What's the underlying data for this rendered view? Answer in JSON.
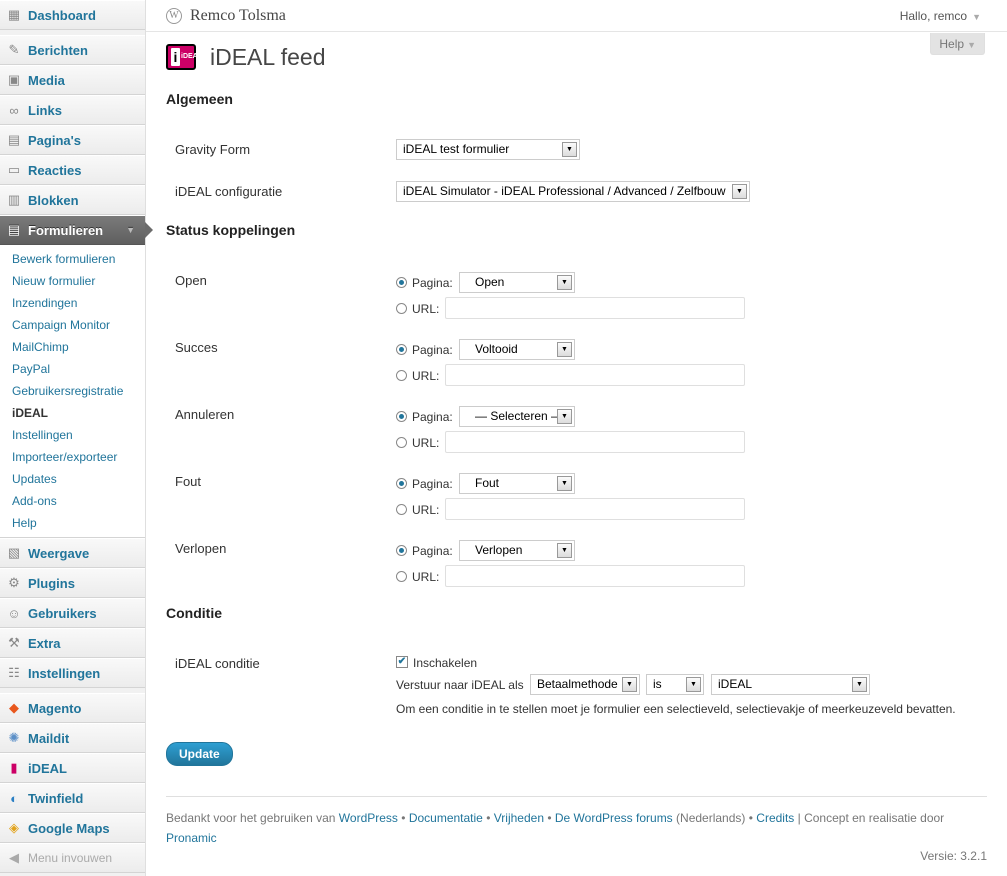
{
  "sidebar": {
    "top_items": [
      {
        "label": "Dashboard",
        "icon": "dashboard-icon"
      },
      {
        "label": "Berichten",
        "icon": "pin-icon"
      },
      {
        "label": "Media",
        "icon": "media-icon"
      },
      {
        "label": "Links",
        "icon": "links-icon"
      },
      {
        "label": "Pagina's",
        "icon": "pages-icon"
      },
      {
        "label": "Reacties",
        "icon": "comments-icon"
      },
      {
        "label": "Blokken",
        "icon": "blocks-icon"
      },
      {
        "label": "Formulieren",
        "icon": "forms-icon"
      }
    ],
    "submenu": [
      "Bewerk formulieren",
      "Nieuw formulier",
      "Inzendingen",
      "Campaign Monitor",
      "MailChimp",
      "PayPal",
      "Gebruikersregistratie",
      "iDEAL",
      "Instellingen",
      "Importeer/exporteer",
      "Updates",
      "Add-ons",
      "Help"
    ],
    "lower_items": [
      {
        "label": "Weergave",
        "icon": "appearance-icon"
      },
      {
        "label": "Plugins",
        "icon": "plugins-icon"
      },
      {
        "label": "Gebruikers",
        "icon": "users-icon"
      },
      {
        "label": "Extra",
        "icon": "tools-icon"
      },
      {
        "label": "Instellingen",
        "icon": "settings-icon"
      }
    ],
    "plugin_items": [
      {
        "label": "Magento",
        "icon": "magento-icon"
      },
      {
        "label": "Maildit",
        "icon": "maildit-icon"
      },
      {
        "label": "iDEAL",
        "icon": "ideal-icon"
      },
      {
        "label": "Twinfield",
        "icon": "twinfield-icon"
      },
      {
        "label": "Google Maps",
        "icon": "google-maps-icon"
      }
    ],
    "collapse_label": "Menu invouwen"
  },
  "header": {
    "site_title": "Remco Tolsma",
    "howdy": "Hallo, remco",
    "help": "Help"
  },
  "page": {
    "title": "iDEAL feed",
    "logo_text": "iDEAL"
  },
  "sections": {
    "general": "Algemeen",
    "status": "Status koppelingen",
    "condition": "Conditie"
  },
  "general": {
    "gravity_form_label": "Gravity Form",
    "gravity_form_value": "iDEAL test formulier",
    "config_label": "iDEAL configuratie",
    "config_value": "iDEAL Simulator - iDEAL Professional / Advanced / Zelfbouw"
  },
  "status_rows": [
    {
      "label": "Open",
      "page": "Open"
    },
    {
      "label": "Succes",
      "page": "Voltooid"
    },
    {
      "label": "Annuleren",
      "page": "— Selecteren —"
    },
    {
      "label": "Fout",
      "page": "Fout"
    },
    {
      "label": "Verlopen",
      "page": "Verlopen"
    }
  ],
  "status_common": {
    "page_label": "Pagina:",
    "url_label": "URL:"
  },
  "condition": {
    "label": "iDEAL conditie",
    "enable_label": "Inschakelen",
    "send_label": "Verstuur naar iDEAL als",
    "field_value": "Betaalmethode",
    "operator_value": "is",
    "match_value": "iDEAL",
    "help_text": "Om een conditie in te stellen moet je formulier een selectieveld, selectievakje of meerkeuzeveld bevatten."
  },
  "update_button": "Update",
  "footer": {
    "thanks": "Bedankt voor het gebruiken van",
    "wordpress": "WordPress",
    "docs": "Documentatie",
    "freedoms": "Vrijheden",
    "forums": "De WordPress forums",
    "lang": "(Nederlands)",
    "credits": "Credits",
    "concept": "| Concept en realisatie door",
    "pronamic": "Pronamic",
    "version": "Versie: 3.2.1"
  }
}
